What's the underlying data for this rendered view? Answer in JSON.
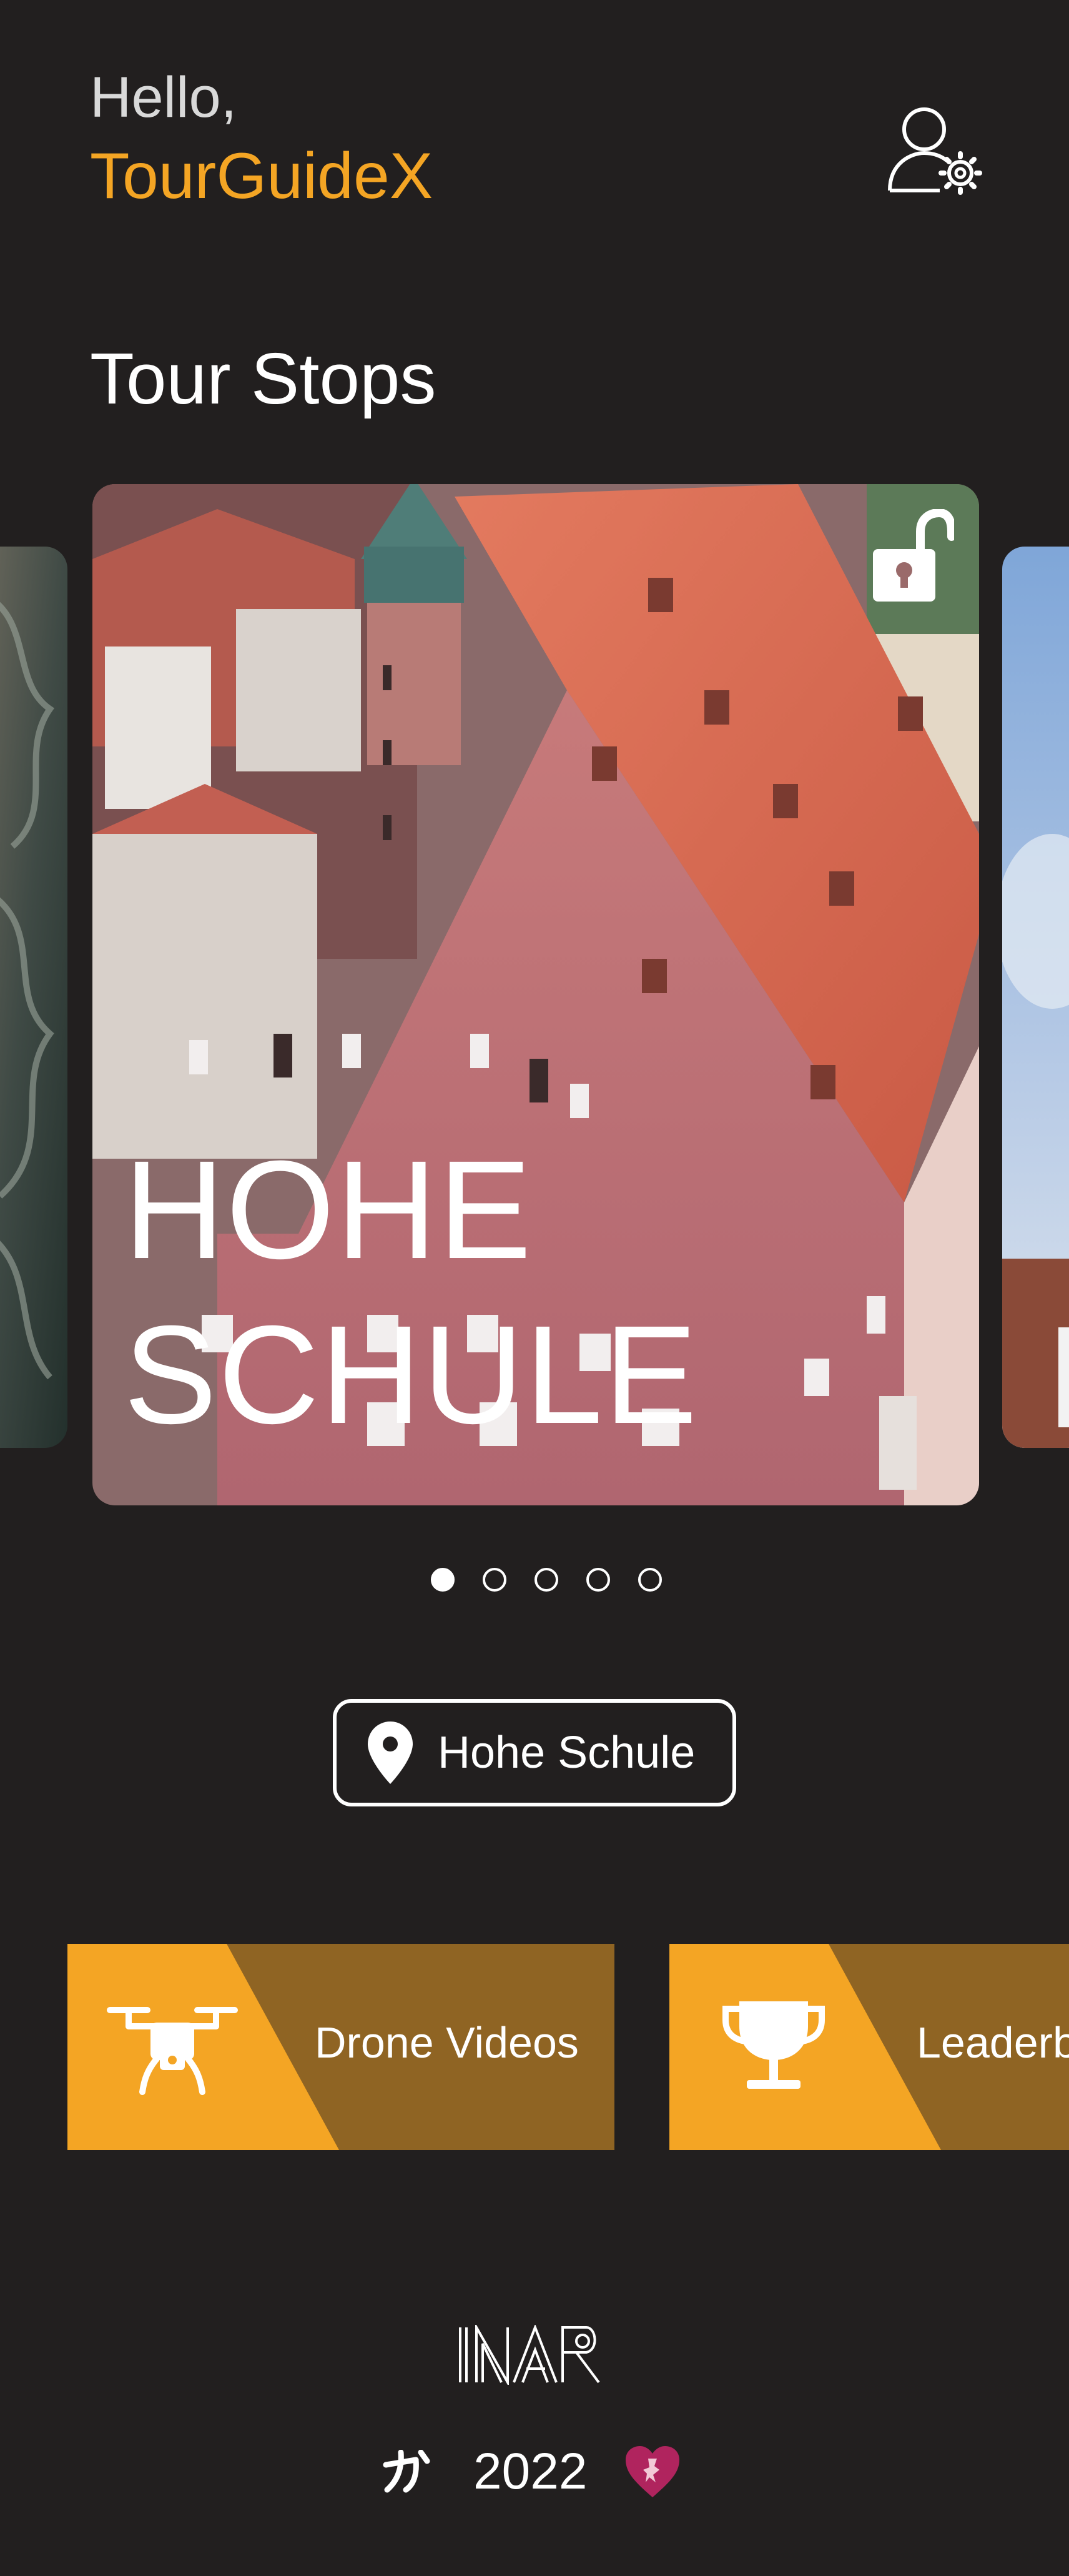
{
  "header": {
    "greeting": "Hello,",
    "username": "TourGuideX",
    "settings_icon": "user-settings-icon"
  },
  "tour": {
    "section_title": "Tour Stops",
    "cards": [
      {
        "title_line1": "",
        "title_line2": ""
      },
      {
        "title_line1": "HOHE",
        "title_line2": "SCHULE",
        "locked": false,
        "lock_icon": "unlocked-padlock-icon"
      },
      {
        "title_line1": "",
        "title_line2": ""
      }
    ],
    "pagination": {
      "total": 5,
      "active": 1
    }
  },
  "location_button": {
    "label": "Hohe Schule",
    "icon": "map-pin-icon"
  },
  "features": [
    {
      "label": "Drone Videos",
      "icon": "drone-icon"
    },
    {
      "label": "Leaderboard",
      "icon": "trophy-icon"
    }
  ],
  "footer": {
    "logo_text": "INAR",
    "year": "2022"
  },
  "colors": {
    "background": "#221f1f",
    "accent": "#f4a524",
    "accent_dark": "#8f6423"
  }
}
